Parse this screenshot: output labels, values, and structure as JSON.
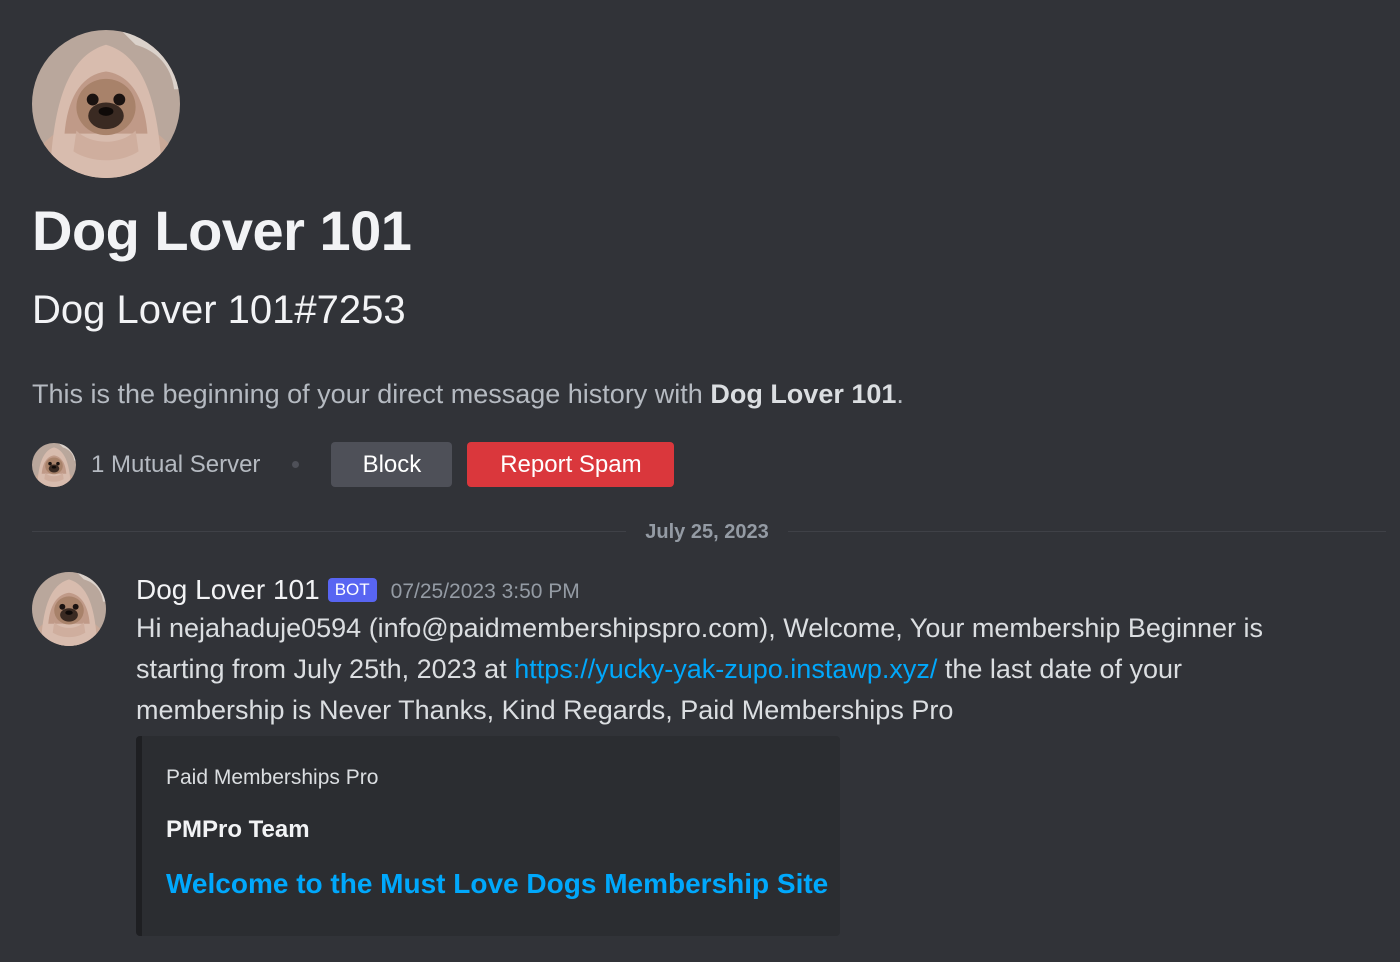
{
  "profile": {
    "display_name": "Dog Lover 101",
    "username": "Dog Lover 101#7253",
    "intro_prefix": "This is the beginning of your direct message history with ",
    "intro_name": "Dog Lover 101",
    "intro_suffix": ".",
    "avatar_icon": "pug-avatar-icon"
  },
  "actions": {
    "mutual_servers": "1 Mutual Server",
    "block_label": "Block",
    "report_label": "Report Spam"
  },
  "divider": {
    "date": "July 25, 2023"
  },
  "message": {
    "author": "Dog Lover 101",
    "tag": "BOT",
    "timestamp": "07/25/2023 3:50 PM",
    "text_before_link": "Hi nejahaduje0594 (info@paidmembershipspro.com), Welcome, Your membership Beginner is starting from July 25th, 2023 at ",
    "link": "https://yucky-yak-zupo.instawp.xyz/",
    "text_after_link": " the last date of your membership is Never Thanks, Kind Regards, Paid Memberships Pro"
  },
  "embed": {
    "provider": "Paid Memberships Pro",
    "author": "PMPro Team",
    "title": "Welcome to the Must Love Dogs Membership Site"
  },
  "colors": {
    "background": "#313338",
    "block_button": "#4e5058",
    "report_button": "#da373c",
    "bot_tag": "#5865f2",
    "link": "#00a8fc"
  }
}
